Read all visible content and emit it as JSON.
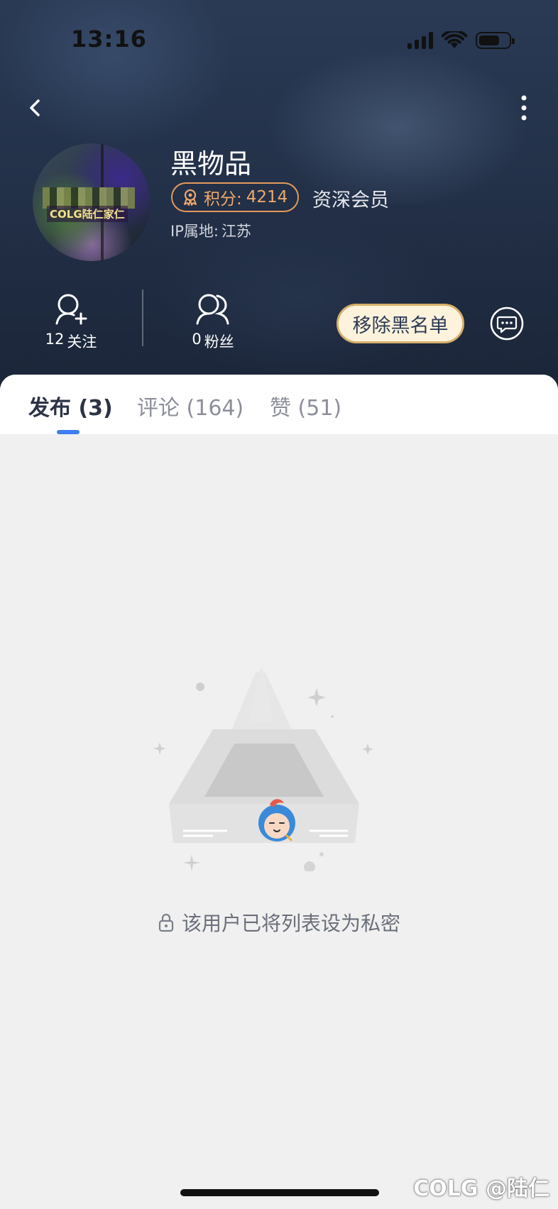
{
  "status_bar": {
    "time": "13:16",
    "icons": [
      "signal-icon",
      "wifi-icon",
      "battery-icon"
    ]
  },
  "nav": {
    "back_icon": "chevron-left-icon",
    "more_icon": "more-vertical-icon"
  },
  "profile": {
    "username": "黑物品",
    "avatar_caption": "COLG陆仁家仁",
    "points_label": "积分:",
    "points_value": "4214",
    "member_level": "资深会员",
    "ip_label": "IP属地:",
    "ip_location": "江苏"
  },
  "stats": {
    "following": {
      "count": "12",
      "label": "关注"
    },
    "followers": {
      "count": "0",
      "label": "粉丝"
    }
  },
  "actions": {
    "remove_blacklist_label": "移除黑名单",
    "message_icon": "chat-bubble-icon"
  },
  "tabs": [
    {
      "label": "发布 (3)",
      "active": true
    },
    {
      "label": "评论 (164)",
      "active": false
    },
    {
      "label": "赞 (51)",
      "active": false
    }
  ],
  "empty_state": {
    "message": "该用户已将列表设为私密",
    "icon": "lock-icon"
  },
  "watermark": "COLG @陆仁",
  "colors": {
    "accent_blue": "#3f7cf2",
    "points_orange": "#f0a76a",
    "blacklist_button_bg": "#fdf3dc",
    "page_bg": "#f0f0f0"
  }
}
